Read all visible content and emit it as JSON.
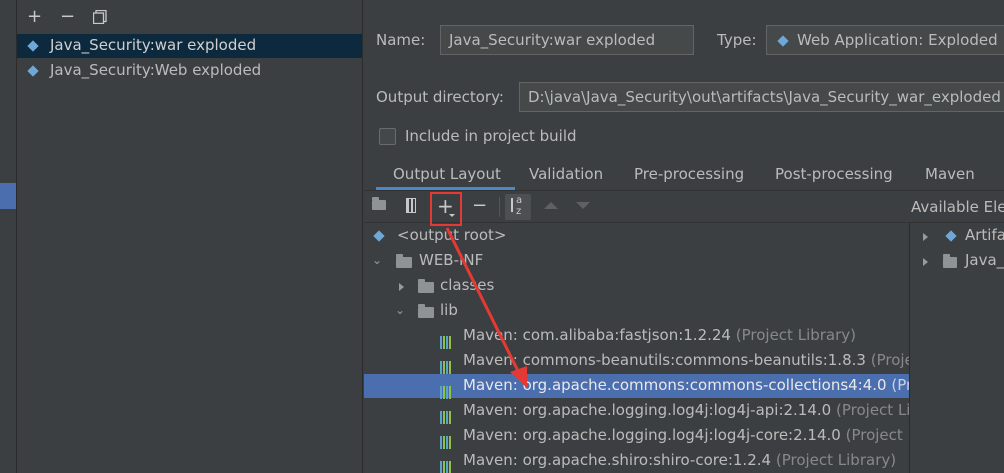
{
  "left_toolbar": {
    "add": "+",
    "remove": "−"
  },
  "artifacts": [
    {
      "label": "Java_Security:war exploded",
      "selected": true
    },
    {
      "label": "Java_Security:Web exploded",
      "selected": false
    }
  ],
  "form": {
    "name_label": "Name:",
    "name_value": "Java_Security:war exploded",
    "type_label": "Type:",
    "type_value": "Web Application: Exploded",
    "output_dir_label": "Output directory:",
    "output_dir_value": "D:\\java\\Java_Security\\out\\artifacts\\Java_Security_war_exploded",
    "include_build_label": "Include in project build",
    "include_build_checked": false
  },
  "tabs": [
    {
      "label": "Output Layout",
      "active": true
    },
    {
      "label": "Validation",
      "active": false
    },
    {
      "label": "Pre-processing",
      "active": false
    },
    {
      "label": "Post-processing",
      "active": false
    },
    {
      "label": "Maven",
      "active": false
    }
  ],
  "layout_toolbar": {
    "add": "+",
    "remove": "−",
    "sort_top": "a",
    "sort_bottom": "z"
  },
  "available_elements_label": "Available Ele",
  "tree": {
    "output_root": "<output root>",
    "web_inf": "WEB-INF",
    "classes": "classes",
    "lib": "lib",
    "libraries": [
      {
        "name": "Maven: com.alibaba:fastjson:1.2.24",
        "suffix": "(Project Library)",
        "selected": false
      },
      {
        "name": "Maven: commons-beanutils:commons-beanutils:1.8.3",
        "suffix": "(Project",
        "selected": false
      },
      {
        "name": "Maven: org.apache.commons:commons-collections4:4.0",
        "suffix": "(Pro",
        "selected": true
      },
      {
        "name": "Maven: org.apache.logging.log4j:log4j-api:2.14.0",
        "suffix": "(Project Lib",
        "selected": false
      },
      {
        "name": "Maven: org.apache.logging.log4j:log4j-core:2.14.0",
        "suffix": "(Project Li",
        "selected": false
      },
      {
        "name": "Maven: org.apache.shiro:shiro-core:1.2.4",
        "suffix": "(Project Library)",
        "selected": false
      }
    ]
  },
  "available_tree": [
    {
      "label": "Artifa"
    },
    {
      "label": "Java_S"
    }
  ],
  "colors": {
    "background": "#3c3f41",
    "selection": "#4b6eaf",
    "list_selection": "#0d293e",
    "highlight_box": "#e53935",
    "annotation_arrow": "#e53935"
  }
}
